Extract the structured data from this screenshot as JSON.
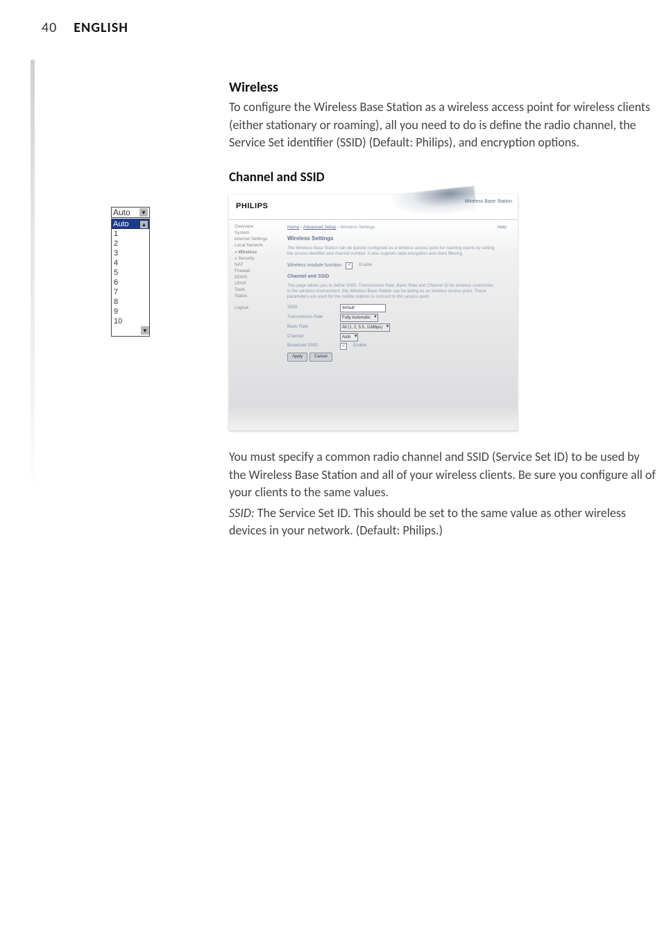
{
  "header": {
    "page_number": "40",
    "language": "ENGLISH"
  },
  "sections": {
    "wireless_title": "Wireless",
    "wireless_para": "To configure the Wireless Base Station as a wireless access point for wireless clients (either stationary or roaming), all you need to do is define the radio channel, the Service Set identifier (SSID) (Default: Philips), and encryption options.",
    "channel_ssid_title": "Channel and SSID",
    "spec_para": "You must specify a common radio channel and SSID (Service Set ID) to be used by the Wireless Base Station and all of your wireless clients. Be sure you configure all of your clients to the same values.",
    "ssid_label": "SSID:",
    "ssid_para": " The Service Set ID. This should be set to the same value as other wireless devices in your network. (Default: Philips.)"
  },
  "margin_illus": {
    "closed_value": "Auto",
    "open_value": "Auto",
    "options": [
      "1",
      "2",
      "3",
      "4",
      "5",
      "6",
      "7",
      "8",
      "9",
      "10"
    ]
  },
  "shot": {
    "brand": "PHILIPS",
    "product": "Wireless Base Station",
    "breadcrumb": {
      "home": "Home",
      "mid": "Advanced Setup",
      "cur": "Wireless Settings"
    },
    "help": "Help",
    "panel_title": "Wireless Settings",
    "desc": "The Wireless Base Station can be quickly configured as a wireless access point for roaming clients by setting the access identifier and channel number. It also supports data encryption and client filtering.",
    "module_label": "Wireless module function",
    "module_enable": "Enable",
    "sub_title": "Channel and SSID",
    "sub_desc": "This page allows you to define SSID, Transmission Rate, Basic Rate and Channel ID for wireless connection. In the wireless environment, this Wireless Base Station can be acting as an wireless access point. These parameters are used for the mobile stations to connect to this access point.",
    "fields": {
      "ssid_label": "SSID",
      "ssid_value": "default",
      "tx_label": "Transmission Rate",
      "tx_value": "Fully Automatic",
      "basic_label": "Basic Rate",
      "basic_value": "All (1, 2, 5.5, 11Mbps)",
      "channel_label": "Channel",
      "channel_value": "Auto",
      "bcast_label": "Broadcast SSID",
      "bcast_value": "Enable"
    },
    "buttons": {
      "apply": "Apply",
      "cancel": "Cancel"
    },
    "nav": {
      "overview": "Overview",
      "system": "System",
      "inet": "Internet Settings",
      "local": "Local Network",
      "wireless": "» Wireless",
      "security": "» Security",
      "nat": "NAT",
      "firewall": "Firewall",
      "ddns": "DDNS",
      "upnp": "UPnP",
      "tools": "Tools",
      "status": "Status",
      "logout": "Logout"
    }
  }
}
